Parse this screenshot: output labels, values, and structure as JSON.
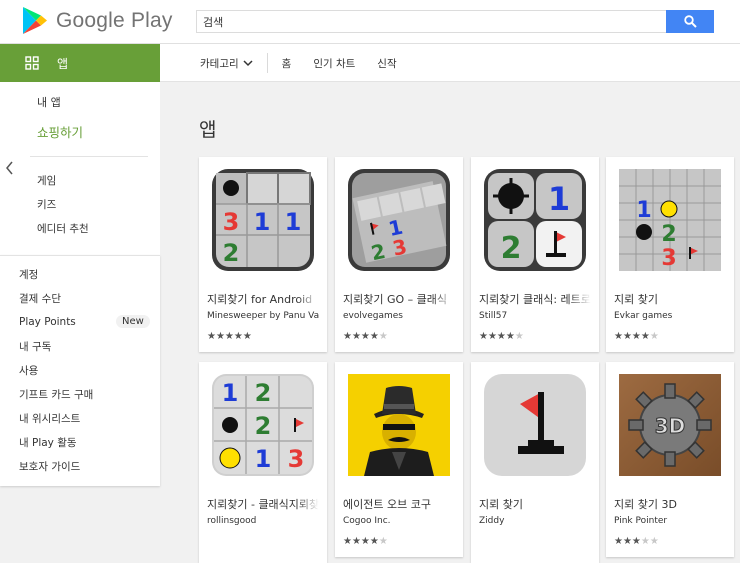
{
  "header": {
    "brand": "Google Play",
    "search_placeholder": "검색",
    "search_value": "검색"
  },
  "subnav": {
    "apps_tab": "앱",
    "category": "카테고리",
    "home": "홈",
    "top_charts": "인기 차트",
    "new_releases": "신작"
  },
  "sidebar": {
    "my_apps": "내 앱",
    "shop": "쇼핑하기",
    "games": "게임",
    "kids": "키즈",
    "editors_choice": "에디터 추천",
    "account": "계정",
    "payment": "결제 수단",
    "play_points": "Play Points",
    "new_badge": "New",
    "subscriptions": "내 구독",
    "redeem": "사용",
    "buy_gift": "기프트 카드 구매",
    "wishlist": "내 위시리스트",
    "play_activity": "내 Play 활동",
    "parent_guide": "보호자 가이드"
  },
  "main": {
    "title": "앱",
    "apps": [
      {
        "name": "지뢰찾기 for Android",
        "developer": "Minesweeper by Panu Valtonen",
        "rating": 5
      },
      {
        "name": "지뢰찾기 GO – 클래식",
        "developer": "evolvegames",
        "rating": 4.5
      },
      {
        "name": "지뢰찾기 클래식: 레트로",
        "developer": "Still57",
        "rating": 4.5
      },
      {
        "name": "지뢰 찾기",
        "developer": "Evkar games",
        "rating": 4.5
      },
      {
        "name": "지뢰찾기 - 클래식지뢰찾기",
        "developer": "rollinsgood",
        "rating": 0
      },
      {
        "name": "에이전트 오브 코구",
        "developer": "Cogoo Inc.",
        "rating": 4.5
      },
      {
        "name": "지뢰 찾기",
        "developer": "Ziddy",
        "rating": 0
      },
      {
        "name": "지뢰 찾기 3D",
        "developer": "Pink Pointer",
        "rating": 3.5
      }
    ]
  },
  "colors": {
    "accent_green": "#689f38",
    "search_blue": "#4285f4"
  }
}
